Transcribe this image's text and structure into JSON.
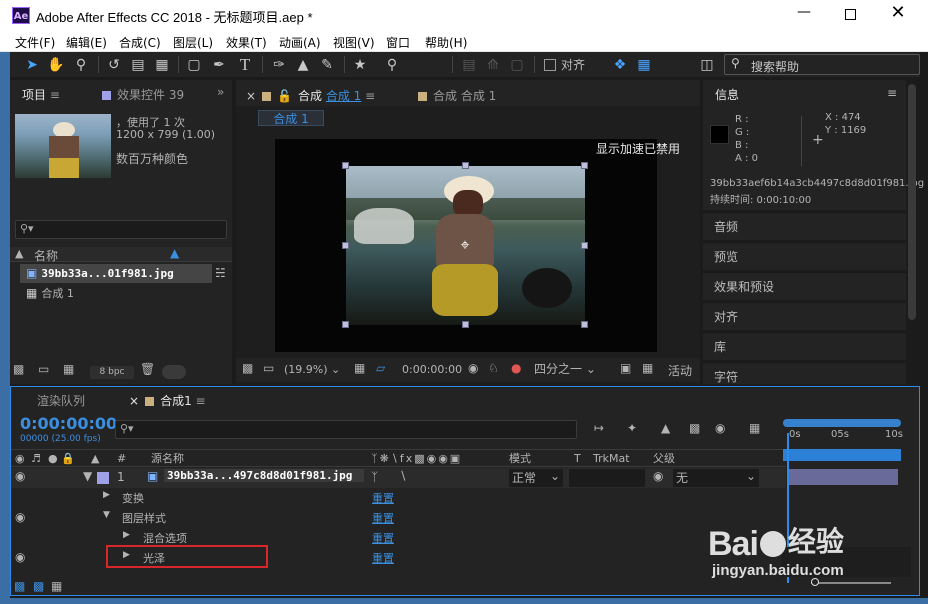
{
  "window": {
    "title": "Adobe After Effects CC 2018 - 无标题项目.aep *",
    "app_badge": "Ae"
  },
  "menu": [
    "文件(F)",
    "编辑(E)",
    "合成(C)",
    "图层(L)",
    "效果(T)",
    "动画(A)",
    "视图(V)",
    "窗口",
    "帮助(H)"
  ],
  "toolbar": {
    "align_label": "对齐",
    "search_help_placeholder": "搜索帮助"
  },
  "project_panel": {
    "tab_project": "项目",
    "tab_effects": "效果控件 39",
    "thumb_usage": "，使用了 1 次",
    "thumb_dims": "1200 x 799 (1.00)",
    "thumb_colors": "数百万种颜色",
    "col_name": "名称",
    "items": [
      "39bb33a...01f981.jpg",
      "合成 1"
    ],
    "bpc": "8 bpc"
  },
  "comp_panel": {
    "tab1_prefix": "合成",
    "tab1_name": "合成 1",
    "tab2": "合成 合成 1",
    "breadcrumb": "合成 1",
    "accel_notice": "显示加速已禁用",
    "zoom": "(19.9%)",
    "timecode": "0:00:00:00",
    "resolution": "四分之一",
    "active": "活动"
  },
  "info_panel": {
    "title": "信息",
    "r": "R :",
    "g": "G :",
    "b": "B :",
    "a": "A : 0",
    "x": "X : 474",
    "y": "Y : 1169",
    "filename": "39bb33aef6b14a3cb4497c8d8d01f981.jpg",
    "duration": "持续时间: 0:00:10:00"
  },
  "stack_panels": [
    "音频",
    "预览",
    "效果和预设",
    "对齐",
    "库",
    "字符"
  ],
  "timeline": {
    "tab_render": "渲染队列",
    "tab_comp": "合成1",
    "timecode": "0:00:00:00",
    "frames": "00000 (25.00 fps)",
    "col_num": "#",
    "col_source": "源名称",
    "col_mode": "模式",
    "col_t": "T",
    "col_trkmat": "TrkMat",
    "col_parent": "父级",
    "layer_num": "1",
    "layer_name": "39bb33a...497c8d8d01f981.jpg",
    "layer_mode": "正常",
    "layer_parent": "无",
    "rows": [
      {
        "label": "变换",
        "action": "重置"
      },
      {
        "label": "图层样式",
        "action": "重置"
      },
      {
        "label": "混合选项",
        "action": "重置"
      },
      {
        "label": "光泽",
        "action": "重置"
      }
    ],
    "ruler": [
      "0s",
      "05s",
      "10s"
    ]
  },
  "watermark": {
    "brand": "Bai",
    "brand2": "经验",
    "url": "jingyan.baidu.com"
  },
  "colors": {
    "accent": "#2d8ceb",
    "panel": "#232323",
    "highlight_box": "#d8262b"
  }
}
